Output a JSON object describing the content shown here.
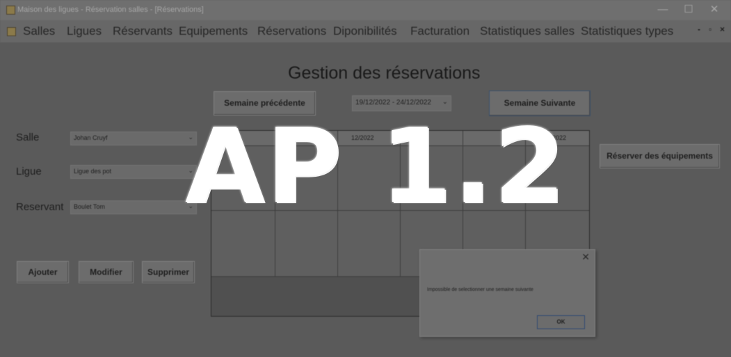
{
  "window": {
    "title": "Maison des ligues - Réservation salles - [Réservations]",
    "minimize": "—",
    "maximize": "☐",
    "close": "✕"
  },
  "menu": {
    "items": [
      "Salles",
      "Ligues",
      "Réservants",
      "Equipements",
      "Réservations",
      "Diponibilités",
      "Facturation",
      "Statistiques salles",
      "Statistiques types"
    ],
    "mdi_minimize": "-",
    "mdi_restore": "▫",
    "mdi_close": "×"
  },
  "page": {
    "title": "Gestion des réservations",
    "prev_week": "Semaine précédente",
    "next_week": "Semaine Suivante",
    "week_range": "19/12/2022 - 24/12/2022",
    "reserve_equipment": "Réserver des équipements"
  },
  "form": {
    "salle_label": "Salle",
    "salle_value": "Johan Cruyf",
    "ligue_label": "Ligue",
    "ligue_value": "Ligue des pot",
    "reservant_label": "Reservant",
    "reservant_value": "Boulet Tom",
    "add": "Ajouter",
    "modify": "Modifier",
    "delete": "Supprimer"
  },
  "grid": {
    "headers": [
      "",
      "",
      "12/2022",
      "",
      "",
      "24/12/2022"
    ]
  },
  "dialog": {
    "message": "Impossible de selectionner une semaine suivante",
    "ok": "OK",
    "close": "✕"
  },
  "overlay": {
    "text": "AP 1.2"
  },
  "colors": {
    "overlay_text": "#ffffff",
    "dim_background": "#5a5a5a"
  }
}
